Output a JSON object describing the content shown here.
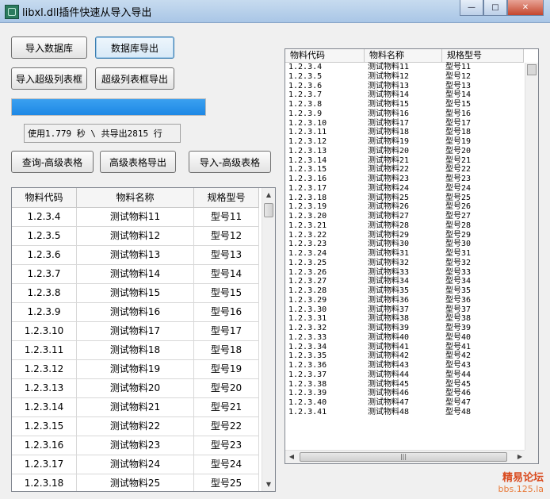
{
  "window": {
    "title": "libxl.dll插件快速从导入导出",
    "minimize_glyph": "—",
    "maximize_glyph": "□",
    "close_glyph": "✕"
  },
  "buttons": {
    "import_db": "导入数据库",
    "export_db": "数据库导出",
    "import_super_list": "导入超级列表框",
    "export_super_list": "超级列表框导出",
    "query_adv_table": "查询-高级表格",
    "export_adv_table": "高级表格导出",
    "import_adv_table": "导入-高级表格"
  },
  "progress": {
    "value_fraction": 1.0,
    "color": "#1e88e5"
  },
  "status_text": "使用1.779 秒 \\ 共导出2815 行",
  "left_table": {
    "headers": [
      "物料代码",
      "物料名称",
      "规格型号"
    ],
    "rows": [
      [
        "1.2.3.4",
        "测试物料11",
        "型号11"
      ],
      [
        "1.2.3.5",
        "测试物料12",
        "型号12"
      ],
      [
        "1.2.3.6",
        "测试物料13",
        "型号13"
      ],
      [
        "1.2.3.7",
        "测试物料14",
        "型号14"
      ],
      [
        "1.2.3.8",
        "测试物料15",
        "型号15"
      ],
      [
        "1.2.3.9",
        "测试物料16",
        "型号16"
      ],
      [
        "1.2.3.10",
        "测试物料17",
        "型号17"
      ],
      [
        "1.2.3.11",
        "测试物料18",
        "型号18"
      ],
      [
        "1.2.3.12",
        "测试物料19",
        "型号19"
      ],
      [
        "1.2.3.13",
        "测试物料20",
        "型号20"
      ],
      [
        "1.2.3.14",
        "测试物料21",
        "型号21"
      ],
      [
        "1.2.3.15",
        "测试物料22",
        "型号22"
      ],
      [
        "1.2.3.16",
        "测试物料23",
        "型号23"
      ],
      [
        "1.2.3.17",
        "测试物料24",
        "型号24"
      ],
      [
        "1.2.3.18",
        "测试物料25",
        "型号25"
      ]
    ]
  },
  "right_list": {
    "headers": [
      "物料代码",
      "物料名称",
      "规格型号"
    ],
    "rows": [
      [
        "1.2.3.4",
        "测试物料11",
        "型号11"
      ],
      [
        "1.2.3.5",
        "测试物料12",
        "型号12"
      ],
      [
        "1.2.3.6",
        "测试物料13",
        "型号13"
      ],
      [
        "1.2.3.7",
        "测试物料14",
        "型号14"
      ],
      [
        "1.2.3.8",
        "测试物料15",
        "型号15"
      ],
      [
        "1.2.3.9",
        "测试物料16",
        "型号16"
      ],
      [
        "1.2.3.10",
        "测试物料17",
        "型号17"
      ],
      [
        "1.2.3.11",
        "测试物料18",
        "型号18"
      ],
      [
        "1.2.3.12",
        "测试物料19",
        "型号19"
      ],
      [
        "1.2.3.13",
        "测试物料20",
        "型号20"
      ],
      [
        "1.2.3.14",
        "测试物料21",
        "型号21"
      ],
      [
        "1.2.3.15",
        "测试物料22",
        "型号22"
      ],
      [
        "1.2.3.16",
        "测试物料23",
        "型号23"
      ],
      [
        "1.2.3.17",
        "测试物料24",
        "型号24"
      ],
      [
        "1.2.3.18",
        "测试物料25",
        "型号25"
      ],
      [
        "1.2.3.19",
        "测试物料26",
        "型号26"
      ],
      [
        "1.2.3.20",
        "测试物料27",
        "型号27"
      ],
      [
        "1.2.3.21",
        "测试物料28",
        "型号28"
      ],
      [
        "1.2.3.22",
        "测试物料29",
        "型号29"
      ],
      [
        "1.2.3.23",
        "测试物料30",
        "型号30"
      ],
      [
        "1.2.3.24",
        "测试物料31",
        "型号31"
      ],
      [
        "1.2.3.25",
        "测试物料32",
        "型号32"
      ],
      [
        "1.2.3.26",
        "测试物料33",
        "型号33"
      ],
      [
        "1.2.3.27",
        "测试物料34",
        "型号34"
      ],
      [
        "1.2.3.28",
        "测试物料35",
        "型号35"
      ],
      [
        "1.2.3.29",
        "测试物料36",
        "型号36"
      ],
      [
        "1.2.3.30",
        "测试物料37",
        "型号37"
      ],
      [
        "1.2.3.31",
        "测试物料38",
        "型号38"
      ],
      [
        "1.2.3.32",
        "测试物料39",
        "型号39"
      ],
      [
        "1.2.3.33",
        "测试物料40",
        "型号40"
      ],
      [
        "1.2.3.34",
        "测试物料41",
        "型号41"
      ],
      [
        "1.2.3.35",
        "测试物料42",
        "型号42"
      ],
      [
        "1.2.3.36",
        "测试物料43",
        "型号43"
      ],
      [
        "1.2.3.37",
        "测试物料44",
        "型号44"
      ],
      [
        "1.2.3.38",
        "测试物料45",
        "型号45"
      ],
      [
        "1.2.3.39",
        "测试物料46",
        "型号46"
      ],
      [
        "1.2.3.40",
        "测试物料47",
        "型号47"
      ],
      [
        "1.2.3.41",
        "测试物料48",
        "型号48"
      ]
    ]
  },
  "watermark": {
    "line1": "精易论坛",
    "line2": "bbs.125.la"
  }
}
